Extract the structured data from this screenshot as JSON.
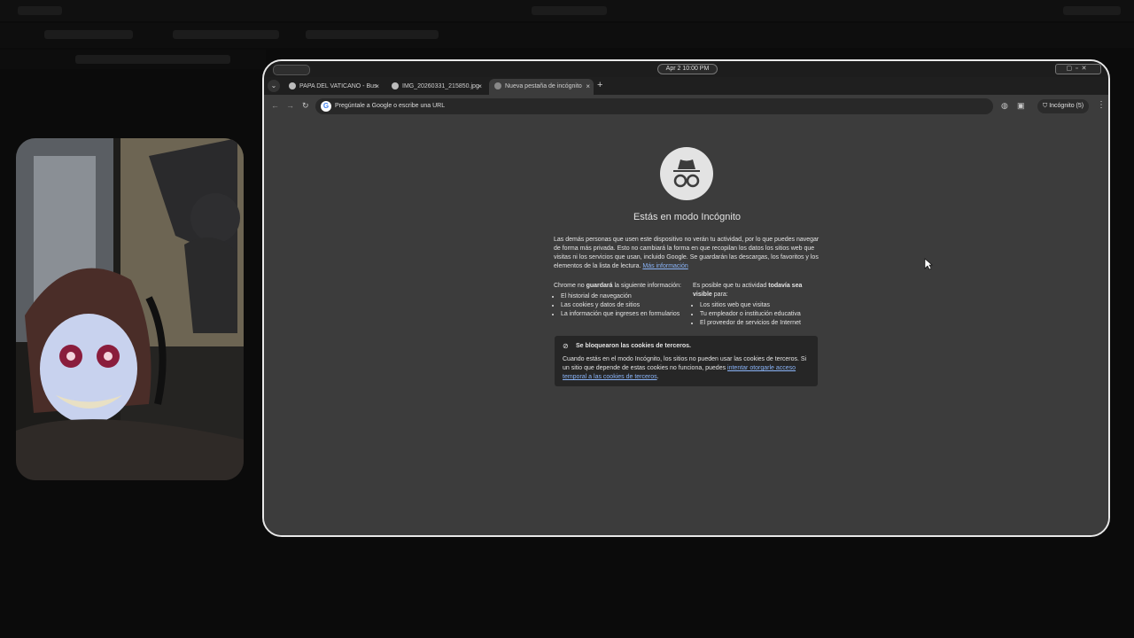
{
  "os": {
    "clock": "Apr 2  10:00 PM"
  },
  "tabs": [
    {
      "title": "PAPA DEL VATICANO - Bus",
      "close": "×"
    },
    {
      "title": "IMG_20260331_215850.jpg",
      "close": "×"
    },
    {
      "title": "Nueva pestaña de incógnito",
      "close": "×"
    }
  ],
  "tab_menu": "⌄",
  "new_tab": "+",
  "toolbar": {
    "back": "←",
    "forward": "→",
    "reload": "↻",
    "google_g": "G",
    "omnibox_placeholder": "Pregúntale a Google o escribe una URL",
    "incognito_label": "Incógnito (5)",
    "menu": "⋮"
  },
  "page": {
    "title": "Estás en modo Incógnito",
    "intro": "Las demás personas que usen este dispositivo no verán tu actividad, por lo que puedes navegar de forma más privada. Esto no cambiará la forma en que recopilan los datos los sitios web que visitas ni los servicios que usan, incluido Google. Se guardarán las descargas, los favoritos y los elementos de la lista de lectura.",
    "more_info": "Más información",
    "left_heading_pre": "Chrome no ",
    "left_heading_bold": "guardará",
    "left_heading_post": " la siguiente información:",
    "left_items": [
      "El historial de navegación",
      "Las cookies y datos de sitios",
      "La información que ingreses en formularios"
    ],
    "right_heading_pre": "Es posible que tu actividad ",
    "right_heading_bold": "todavía sea visible",
    "right_heading_post": " para:",
    "right_items": [
      "Los sitios web que visitas",
      "Tu empleador o institución educativa",
      "El proveedor de servicios de Internet"
    ],
    "cookie_title": "Se bloquearon las cookies de terceros.",
    "cookie_body": "Cuando estás en el modo Incógnito, los sitios no pueden usar las cookies de terceros. Si un sitio que depende de estas cookies no funciona, puedes ",
    "cookie_link": "intentar otorgarle acceso temporal a las cookies de terceros",
    "cookie_end": "."
  }
}
